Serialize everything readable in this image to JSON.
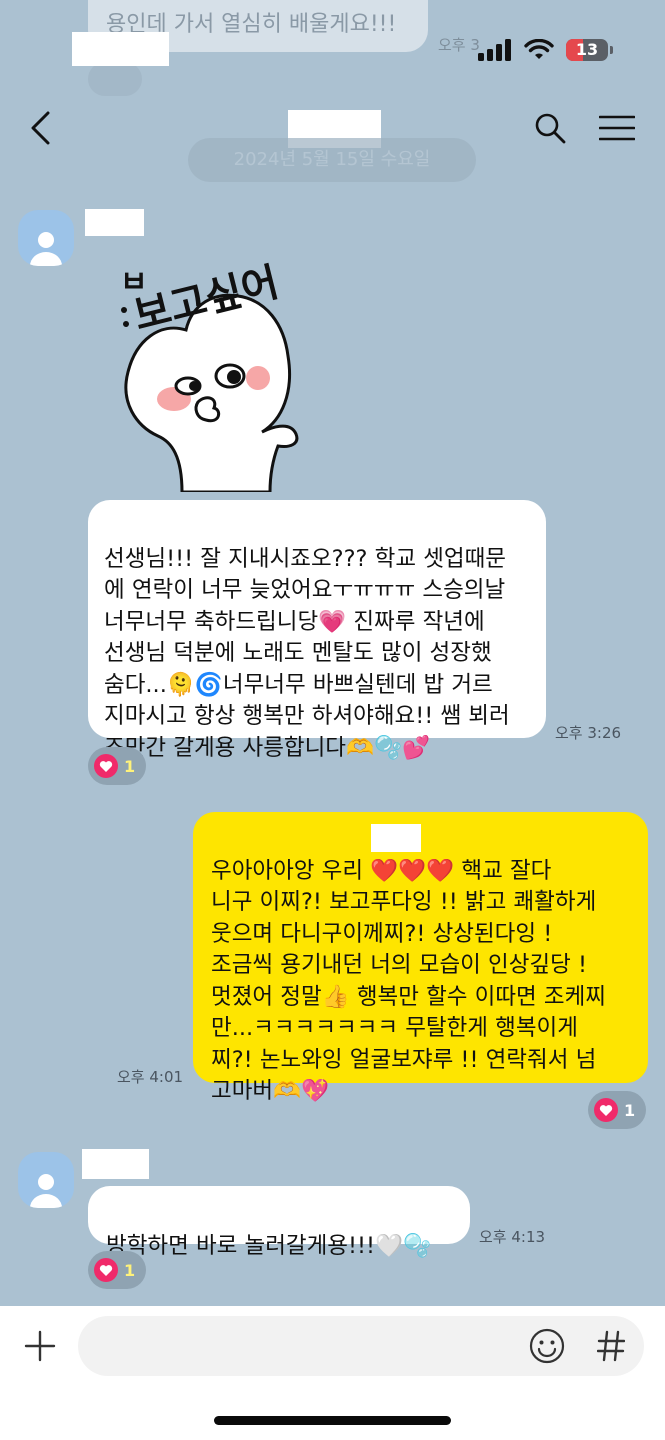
{
  "previous": {
    "text": "용인데 가서 열심히 배울게요!!!",
    "time": "오후 3"
  },
  "status_bar": {
    "battery": "13"
  },
  "header": {
    "icons": [
      "back-icon",
      "search-icon",
      "menu-icon"
    ]
  },
  "date_divider": "2024년 5월 15일 수요일",
  "messages": [
    {
      "side": "left",
      "sticker_text": "보고싶어",
      "sticker_mark": "ㅂ",
      "text": "선생님!!! 잘 지내시죠오??? 학교 셋업때문\n에 연락이 너무 늦었어요ㅜㅠㅠㅠ 스승의날\n너무너무 축하드립니당💗 진짜루 작년에\n선생님 덕분에 노래도 멘탈도 많이 성장했\n숨다...🫠🌀너무너무 바쁘실텐데 밥 거르\n지마시고 항상 행복만 하셔야해요!! 쌤 뵈러\n조만간 갈게용 사릉합니다🫶🫧💕",
      "time": "오후 3:26",
      "reaction_count": "1"
    },
    {
      "side": "right",
      "text": "우아아아앙 우리       ❤️❤️❤️ 핵교 잘다\n니구 이찌?! 보고푸다잉 !! 밝고 쾌활하게\n웃으며 다니구이께찌?! 상상된다잉 !\n조금씩 용기내던 너의 모습이 인상깊당 !\n멋졌어 정말👍 행복만 할수 이따면 조케찌\n만...ㅋㅋㅋㅋㅋㅋㅋ 무탈한게 행복이게\n찌?! 논노와잉 얼굴보쟈루 !! 연락줘서 넘\n고마버🫶💖",
      "time": "오후 4:01",
      "reaction_count": "1"
    },
    {
      "side": "left",
      "text": "방학하면 바로 놀러갈게용!!!🤍🫧",
      "time": "오후 4:13",
      "reaction_count": "1"
    }
  ],
  "input_bar": {
    "placeholder": "",
    "icons": [
      "plus-icon",
      "emoji-icon",
      "hashtag-icon"
    ]
  }
}
